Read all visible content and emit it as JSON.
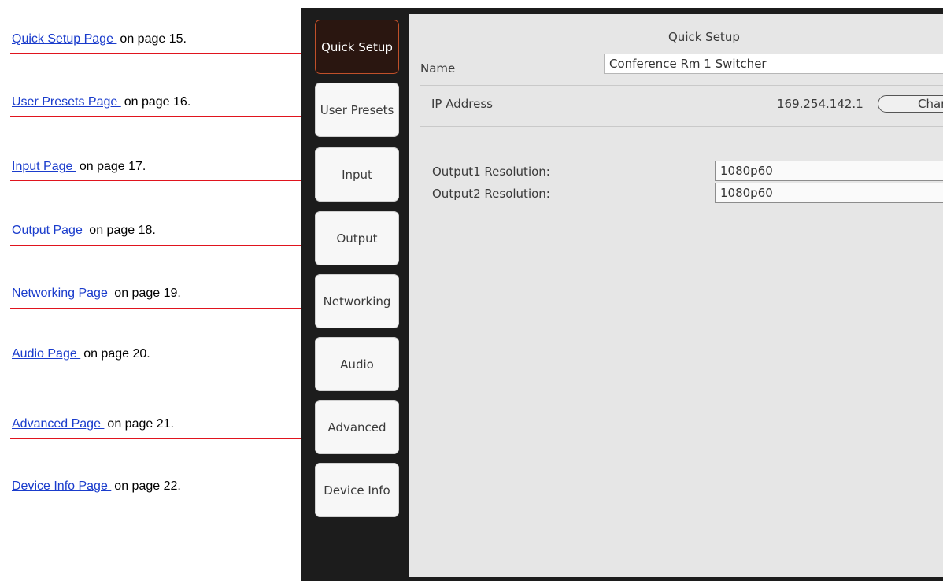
{
  "callouts": [
    {
      "link": "Quick Setup Page ",
      "suffix": "on page 15."
    },
    {
      "link": "User Presets Page ",
      "suffix": "on page 16."
    },
    {
      "link": "Input Page ",
      "suffix": "on page 17."
    },
    {
      "link": "Output Page ",
      "suffix": "on page 18."
    },
    {
      "link": "Networking Page ",
      "suffix": "on page 19."
    },
    {
      "link": "Audio Page ",
      "suffix": "on page 20."
    },
    {
      "link": "Advanced Page ",
      "suffix": "on page 21."
    },
    {
      "link": "Device Info Page ",
      "suffix": "on page 22."
    }
  ],
  "tabs": [
    {
      "label": "Quick Setup",
      "active": true
    },
    {
      "label": "User Presets"
    },
    {
      "label": "Input"
    },
    {
      "label": "Output"
    },
    {
      "label": "Networking"
    },
    {
      "label": "Audio"
    },
    {
      "label": "Advanced"
    },
    {
      "label": "Device Info"
    }
  ],
  "page": {
    "title": "Quick Setup",
    "name_label": "Name",
    "name_value": "Conference Rm 1 Switcher",
    "ip_label": "IP Address",
    "ip_value": "169.254.142.1",
    "change_button": "Chan",
    "output1_label": "Output1 Resolution:",
    "output1_value": "1080p60",
    "output2_label": "Output2 Resolution:",
    "output2_value": "1080p60"
  },
  "colors": {
    "link": "#1a3ccc",
    "leader_line": "#e0141e",
    "active_tab": "#2a1610",
    "device_bg": "#1c1c1c",
    "panel_bg": "#e6e6e6"
  }
}
